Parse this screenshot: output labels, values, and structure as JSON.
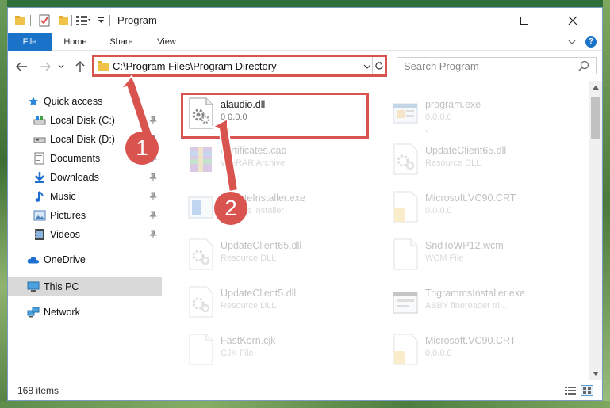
{
  "window": {
    "title": "Program"
  },
  "ribbon": {
    "tabs": [
      "File",
      "Home",
      "Share",
      "View"
    ],
    "help": "?"
  },
  "nav": {
    "address": "C:\\Program Files\\Program Directory",
    "search_placeholder": "Search Program"
  },
  "sidebar": {
    "items": [
      {
        "label": "Quick access",
        "icon": "star-icon"
      },
      {
        "label": "Local Disk (C:)",
        "icon": "drive-icon",
        "pinned": true
      },
      {
        "label": "Local Disk (D:)",
        "icon": "drive-icon",
        "pinned": true
      },
      {
        "label": "Documents",
        "icon": "documents-icon",
        "pinned": true
      },
      {
        "label": "Downloads",
        "icon": "download-icon",
        "pinned": true
      },
      {
        "label": "Music",
        "icon": "music-icon",
        "pinned": true
      },
      {
        "label": "Pictures",
        "icon": "pictures-icon",
        "pinned": true
      },
      {
        "label": "Videos",
        "icon": "videos-icon",
        "pinned": true
      },
      {
        "label": "OneDrive",
        "icon": "cloud-icon"
      },
      {
        "label": "This PC",
        "icon": "computer-icon",
        "selected": true
      },
      {
        "label": "Network",
        "icon": "network-icon"
      }
    ]
  },
  "files": [
    {
      "name": "alaudio.dll",
      "type": "0.0.0.0",
      "sub": "-",
      "icon": "dll-gear-icon",
      "highlighted": true
    },
    {
      "name": "program.exe",
      "type": "0.0.0.0",
      "sub": "-",
      "icon": "exe-icon"
    },
    {
      "name": "certificates.cab",
      "type": "WinRAR Archive",
      "sub": "",
      "icon": "archive-icon"
    },
    {
      "name": "UpdateClient65.dll",
      "type": "Resource DLL",
      "sub": "",
      "icon": "dll-gear-icon"
    },
    {
      "name": "UpdateInstaller.exe",
      "type": "updates installer",
      "sub": "",
      "icon": "installer-icon"
    },
    {
      "name": "Microsoft.VC90.CRT",
      "type": "0.0.0.0",
      "sub": "",
      "icon": "folder-doc-icon"
    },
    {
      "name": "UpdateClient65.dll",
      "type": "Resource DLL",
      "sub": "",
      "icon": "dll-gear-icon"
    },
    {
      "name": "SndToWP12.wcm",
      "type": "WCM File",
      "sub": "",
      "icon": "blank-file-icon"
    },
    {
      "name": "UpdateClient5.dll",
      "type": "Resource DLL",
      "sub": "",
      "icon": "dll-gear-icon"
    },
    {
      "name": "TrigrammsInstaller.exe",
      "type": "ABBY finereader tri...",
      "sub": "",
      "icon": "installer-icon"
    },
    {
      "name": "FastKorn.cjk",
      "type": "CJK File",
      "sub": "",
      "icon": "blank-file-icon"
    },
    {
      "name": "Microsoft.VC90.CRT",
      "type": "0.0.0.0",
      "sub": "",
      "icon": "folder-doc-icon"
    }
  ],
  "status": {
    "count": "168 items"
  },
  "annotations": {
    "step1": "1",
    "step2": "2",
    "color": "#d9534f"
  }
}
